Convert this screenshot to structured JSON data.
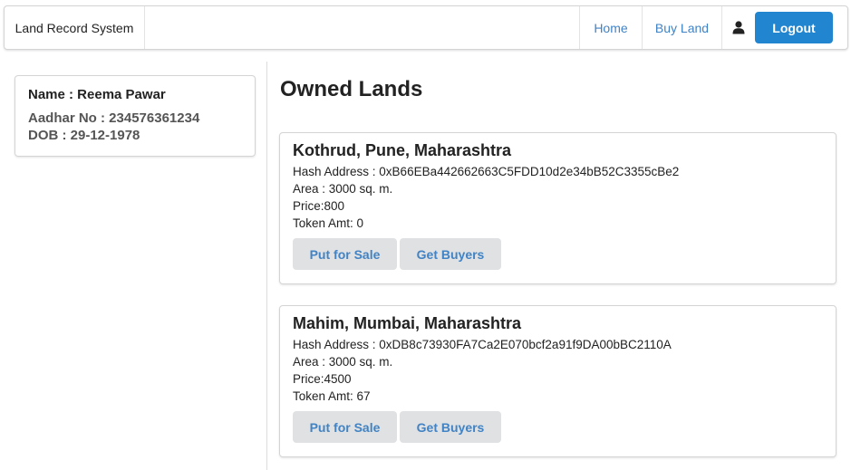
{
  "navbar": {
    "brand": "Land Record System",
    "home_label": "Home",
    "buy_label": "Buy Land",
    "user_icon": "user-icon",
    "logout_label": "Logout",
    "accent_color": "#2185d0"
  },
  "profile": {
    "name": "Name : Reema Pawar",
    "aadhar": "Aadhar No : 234576361234",
    "dob": "DOB : 29-12-1978"
  },
  "main": {
    "title": "Owned Lands",
    "lands": [
      {
        "location": "Kothrud, Pune, Maharashtra",
        "hash": "Hash Address : 0xB66EBa442662663C5FDD10d2e34bB52C3355cBe2",
        "area": "Area : 3000 sq. m.",
        "price": "Price:800",
        "token": "Token Amt: 0",
        "sale_label": "Put for Sale",
        "buyers_label": "Get Buyers"
      },
      {
        "location": "Mahim, Mumbai, Maharashtra",
        "hash": "Hash Address : 0xDB8c73930FA7Ca2E070bcf2a91f9DA00bBC2110A",
        "area": "Area : 3000 sq. m.",
        "price": "Price:4500",
        "token": "Token Amt: 67",
        "sale_label": "Put for Sale",
        "buyers_label": "Get Buyers"
      }
    ]
  }
}
